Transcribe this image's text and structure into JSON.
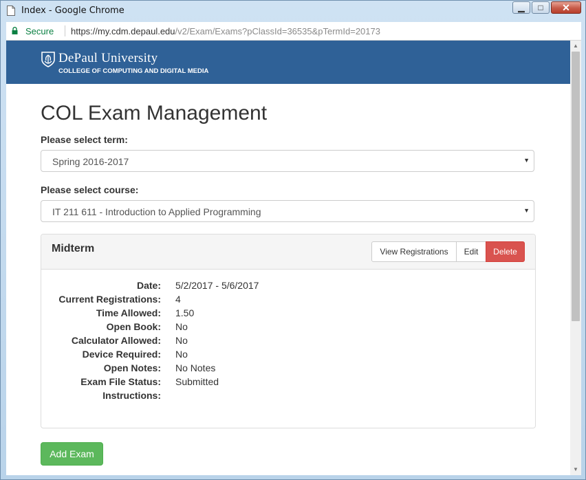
{
  "window": {
    "title": "Index - Google Chrome",
    "controls": {
      "minimize": "▁",
      "maximize": "□",
      "close": "✕"
    }
  },
  "address": {
    "secure_label": "Secure",
    "url_host": "https://my.cdm.depaul.edu",
    "url_path": "/v2/Exam/Exams?pClassId=36535&pTermId=20173"
  },
  "banner": {
    "university": "DePaul University",
    "college": "COLLEGE OF COMPUTING AND DIGITAL MEDIA"
  },
  "page": {
    "title": "COL Exam Management",
    "term_label": "Please select term:",
    "term_value": "Spring 2016-2017",
    "course_label": "Please select course:",
    "course_value": "IT 211 611 - Introduction to Applied Programming"
  },
  "exam": {
    "title": "Midterm",
    "buttons": {
      "view": "View Registrations",
      "edit": "Edit",
      "delete": "Delete"
    },
    "details": [
      {
        "key": "Date:",
        "value": "5/2/2017 - 5/6/2017"
      },
      {
        "key": "Current Registrations:",
        "value": "4"
      },
      {
        "key": "Time Allowed:",
        "value": "1.50"
      },
      {
        "key": "Open Book:",
        "value": "No"
      },
      {
        "key": "Calculator Allowed:",
        "value": "No"
      },
      {
        "key": "Device Required:",
        "value": "No"
      },
      {
        "key": "Open Notes:",
        "value": "No Notes"
      },
      {
        "key": "Exam File Status:",
        "value": "Submitted"
      },
      {
        "key": "Instructions:",
        "value": ""
      }
    ]
  },
  "actions": {
    "add_exam": "Add Exam"
  },
  "colors": {
    "banner": "#2f6197",
    "danger": "#d9534f",
    "success": "#5cb85c",
    "secure": "#0b8043"
  }
}
